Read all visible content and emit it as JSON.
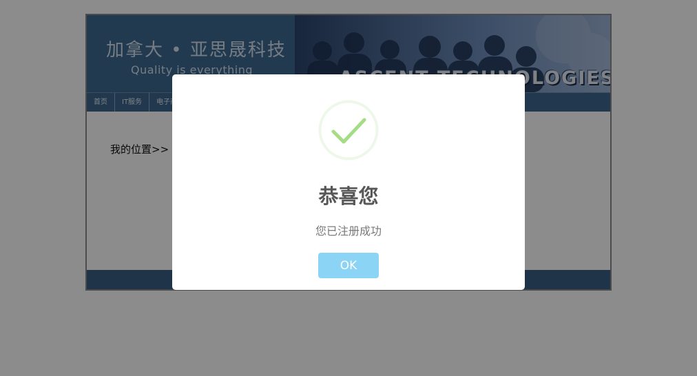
{
  "site": {
    "brand_title": "加拿大 • 亚思晟科技",
    "brand_slogan": "Quality is everything",
    "banner_text": "ASCENT TECHNOLOGIES",
    "nav": [
      {
        "label": "首页"
      },
      {
        "label": "IT服务"
      },
      {
        "label": "电子商务"
      }
    ],
    "breadcrumb": "我的位置>>"
  },
  "dialog": {
    "icon": "success-check-icon",
    "title": "恭喜您",
    "message": "您已注册成功",
    "ok_label": "OK"
  },
  "colors": {
    "overlay": "rgba(0,0,0,0.45)",
    "banner": "#3d6a92",
    "navbar": "#3d6790",
    "footer": "#3a5f86",
    "success_check": "#a5dc86",
    "success_ring": "#eef8ea",
    "ok_button": "#8cd4f5",
    "title_text": "#575757",
    "message_text": "#797979"
  }
}
